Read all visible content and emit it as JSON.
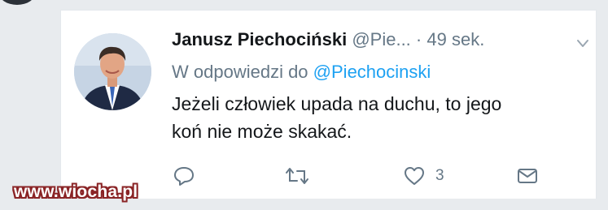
{
  "tweet": {
    "author_name": "Janusz Piechociński",
    "handle": "@Pie...",
    "separator": "·",
    "time": "49 sek.",
    "reply_prefix": "W odpowiedzi do",
    "reply_to": "@Piechocinski",
    "text_lines": [
      "Jeżeli człowiek upada na duchu, to jego",
      "koń nie może skakać."
    ],
    "like_count": "3"
  },
  "watermark": "www.wiocha.pl",
  "colors": {
    "text": "#14171a",
    "muted": "#657786",
    "link": "#1da1f2",
    "background": "#e8ebee"
  },
  "icons": {
    "reply": "reply-icon",
    "retweet": "retweet-icon",
    "like": "heart-icon",
    "dm": "envelope-icon",
    "menu": "chevron-down-icon"
  }
}
